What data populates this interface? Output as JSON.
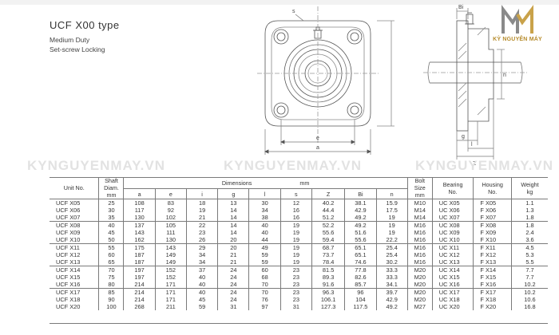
{
  "heading": {
    "title": "UCF X00 type",
    "subtitle": "Medium Duty",
    "subtitle2": "Set-screw Locking"
  },
  "logo": {
    "letter": "M",
    "text": "KỲ NGUYÊN MÁY",
    "color": "#b68b2b"
  },
  "watermark": {
    "text": "KYNGUYENMAY.VN"
  },
  "drawing_labels": {
    "s": "s",
    "a": "a",
    "e": "e",
    "Bi": "Bi",
    "n": "n",
    "l": "l",
    "Z": "Z",
    "g": "g"
  },
  "table": {
    "headers": {
      "unit_no": "Unit No.",
      "shaft_diam": [
        "Shaft",
        "Diam.",
        "mm"
      ],
      "dimensions": "Dimensions",
      "dimensions_unit": "mm",
      "bolt_size": [
        "Bolt",
        "Size",
        "mm"
      ],
      "bearing_no": [
        "Bearing",
        "No."
      ],
      "housing_no": [
        "Housing",
        "No."
      ],
      "weight": [
        "Weight",
        "kg"
      ],
      "dims": [
        "a",
        "e",
        "i",
        "g",
        "l",
        "s",
        "Z",
        "Bi",
        "n"
      ]
    },
    "groups": [
      [
        {
          "unit": "UCF X05",
          "d": "25",
          "a": "108",
          "e": "83",
          "i": "18",
          "g": "13",
          "l": "30",
          "s": "12",
          "z": "40.2",
          "bi": "38.1",
          "n": "15.9",
          "bolt": "M10",
          "bearing": "UC X05",
          "housing": "F X05",
          "weight": "1.1"
        },
        {
          "unit": "UCF X06",
          "d": "30",
          "a": "117",
          "e": "92",
          "i": "19",
          "g": "14",
          "l": "34",
          "s": "16",
          "z": "44.4",
          "bi": "42.9",
          "n": "17.5",
          "bolt": "M14",
          "bearing": "UC X06",
          "housing": "F X06",
          "weight": "1.3"
        },
        {
          "unit": "UCF X07",
          "d": "35",
          "a": "130",
          "e": "102",
          "i": "21",
          "g": "14",
          "l": "38",
          "s": "16",
          "z": "51.2",
          "bi": "49.2",
          "n": "19",
          "bolt": "M14",
          "bearing": "UC X07",
          "housing": "F X07",
          "weight": "1.8"
        }
      ],
      [
        {
          "unit": "UCF X08",
          "d": "40",
          "a": "137",
          "e": "105",
          "i": "22",
          "g": "14",
          "l": "40",
          "s": "19",
          "z": "52.2",
          "bi": "49.2",
          "n": "19",
          "bolt": "M16",
          "bearing": "UC X08",
          "housing": "F X08",
          "weight": "1.8"
        },
        {
          "unit": "UCF X09",
          "d": "45",
          "a": "143",
          "e": "111",
          "i": "23",
          "g": "14",
          "l": "40",
          "s": "19",
          "z": "55.6",
          "bi": "51.6",
          "n": "19",
          "bolt": "M16",
          "bearing": "UC X09",
          "housing": "F X09",
          "weight": "2.4"
        },
        {
          "unit": "UCF X10",
          "d": "50",
          "a": "162",
          "e": "130",
          "i": "26",
          "g": "20",
          "l": "44",
          "s": "19",
          "z": "59.4",
          "bi": "55.6",
          "n": "22.2",
          "bolt": "M16",
          "bearing": "UC X10",
          "housing": "F X10",
          "weight": "3.6"
        }
      ],
      [
        {
          "unit": "UCF X11",
          "d": "55",
          "a": "175",
          "e": "143",
          "i": "29",
          "g": "20",
          "l": "49",
          "s": "19",
          "z": "68.7",
          "bi": "65.1",
          "n": "25.4",
          "bolt": "M16",
          "bearing": "UC X11",
          "housing": "F X11",
          "weight": "4.5"
        },
        {
          "unit": "UCF X12",
          "d": "60",
          "a": "187",
          "e": "149",
          "i": "34",
          "g": "21",
          "l": "59",
          "s": "19",
          "z": "73.7",
          "bi": "65.1",
          "n": "25.4",
          "bolt": "M16",
          "bearing": "UC X12",
          "housing": "F X12",
          "weight": "5.3"
        },
        {
          "unit": "UCF X13",
          "d": "65",
          "a": "187",
          "e": "149",
          "i": "34",
          "g": "21",
          "l": "59",
          "s": "19",
          "z": "78.4",
          "bi": "74.6",
          "n": "30.2",
          "bolt": "M16",
          "bearing": "UC X13",
          "housing": "F X13",
          "weight": "5.5"
        }
      ],
      [
        {
          "unit": "UCF X14",
          "d": "70",
          "a": "197",
          "e": "152",
          "i": "37",
          "g": "24",
          "l": "60",
          "s": "23",
          "z": "81.5",
          "bi": "77.8",
          "n": "33.3",
          "bolt": "M20",
          "bearing": "UC X14",
          "housing": "F X14",
          "weight": "7.7"
        },
        {
          "unit": "UCF X15",
          "d": "75",
          "a": "197",
          "e": "152",
          "i": "40",
          "g": "24",
          "l": "68",
          "s": "23",
          "z": "89.3",
          "bi": "82.6",
          "n": "33.3",
          "bolt": "M20",
          "bearing": "UC X15",
          "housing": "F X15",
          "weight": "7.7"
        },
        {
          "unit": "UCF X16",
          "d": "80",
          "a": "214",
          "e": "171",
          "i": "40",
          "g": "24",
          "l": "70",
          "s": "23",
          "z": "91.6",
          "bi": "85.7",
          "n": "34.1",
          "bolt": "M20",
          "bearing": "UC X16",
          "housing": "F X16",
          "weight": "10.2"
        }
      ],
      [
        {
          "unit": "UCF X17",
          "d": "85",
          "a": "214",
          "e": "171",
          "i": "40",
          "g": "24",
          "l": "70",
          "s": "23",
          "z": "96.3",
          "bi": "96",
          "n": "39.7",
          "bolt": "M20",
          "bearing": "UC X17",
          "housing": "F X17",
          "weight": "10.2"
        },
        {
          "unit": "UCF X18",
          "d": "90",
          "a": "214",
          "e": "171",
          "i": "45",
          "g": "24",
          "l": "76",
          "s": "23",
          "z": "106.1",
          "bi": "104",
          "n": "42.9",
          "bolt": "M20",
          "bearing": "UC X18",
          "housing": "F X18",
          "weight": "10.6"
        },
        {
          "unit": "UCF X20",
          "d": "100",
          "a": "268",
          "e": "211",
          "i": "59",
          "g": "31",
          "l": "97",
          "s": "31",
          "z": "127.3",
          "bi": "117.5",
          "n": "49.2",
          "bolt": "M27",
          "bearing": "UC X20",
          "housing": "F X20",
          "weight": "16.8"
        }
      ]
    ]
  }
}
